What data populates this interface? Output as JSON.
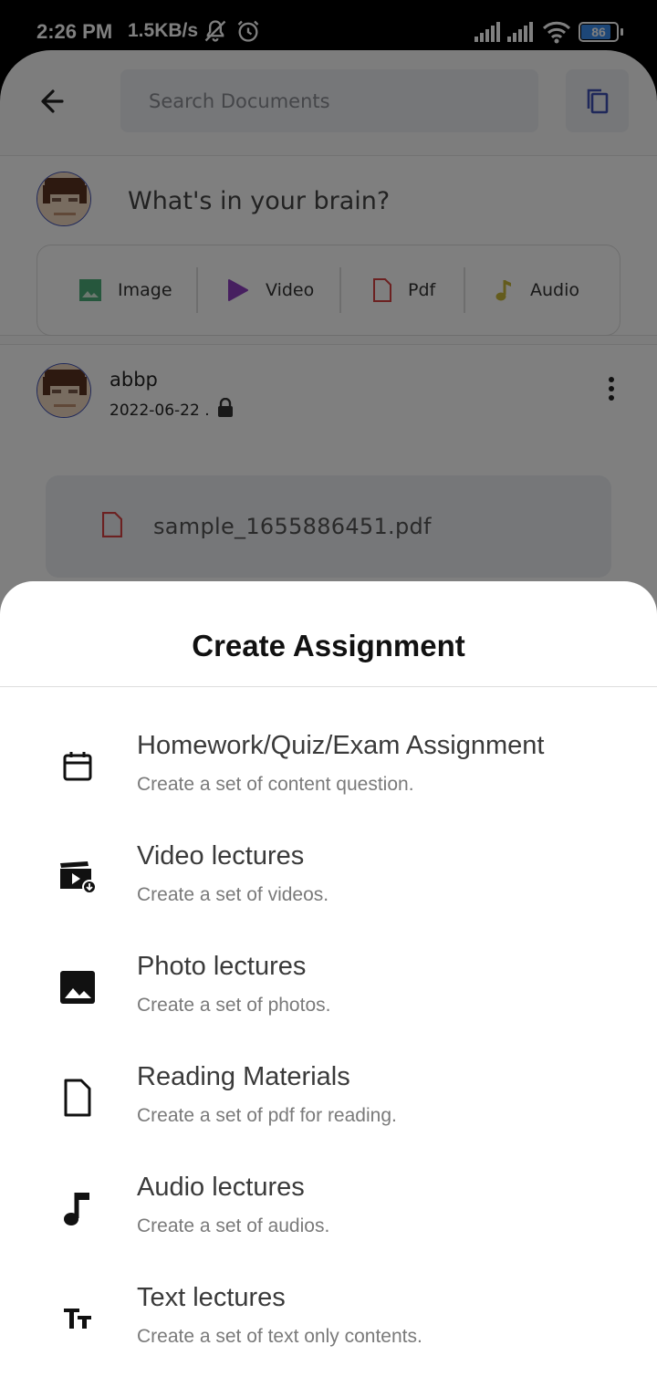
{
  "status_bar": {
    "time": "2:26 PM",
    "speed": "1.5KB/s",
    "battery": "86",
    "battery_level": 0.86,
    "icons": [
      "muted-bell-icon",
      "alarm-icon",
      "signal-icon",
      "signal-icon",
      "wifi-icon",
      "battery-icon"
    ]
  },
  "header": {
    "search_placeholder": "Search Documents",
    "icons": [
      "back-arrow-icon",
      "copy-icon"
    ]
  },
  "compose": {
    "prompt": "What's in your brain?",
    "media": [
      {
        "label": "Image",
        "icon": "image-icon",
        "color": "#4caf7a"
      },
      {
        "label": "Video",
        "icon": "video-play-icon",
        "color": "#8e3fc0"
      },
      {
        "label": "Pdf",
        "icon": "pdf-file-icon",
        "color": "#d84343"
      },
      {
        "label": "Audio",
        "icon": "music-note-icon",
        "color": "#c9b83a"
      }
    ]
  },
  "post": {
    "username": "abbp",
    "date": "2022-06-22 .",
    "attachment": "sample_1655886451.pdf"
  },
  "sheet": {
    "title": "Create Assignment",
    "options": [
      {
        "title": "Homework/Quiz/Exam Assignment",
        "subtitle": "Create a set of content question.",
        "icon": "calendar-icon"
      },
      {
        "title": "Video lectures",
        "subtitle": "Create a set of videos.",
        "icon": "video-clapper-icon"
      },
      {
        "title": "Photo lectures",
        "subtitle": "Create a set of photos.",
        "icon": "image-icon"
      },
      {
        "title": "Reading Materials",
        "subtitle": "Create a set of pdf for reading.",
        "icon": "document-icon"
      },
      {
        "title": "Audio lectures",
        "subtitle": "Create a set of audios.",
        "icon": "music-note-icon"
      },
      {
        "title": "Text lectures",
        "subtitle": "Create a set of text only contents.",
        "icon": "text-fields-icon"
      }
    ]
  }
}
